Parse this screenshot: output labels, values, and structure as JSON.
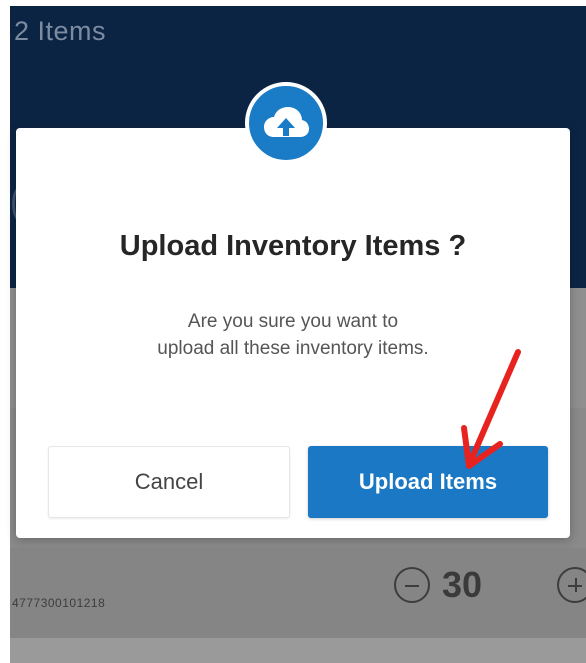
{
  "header": {
    "title": "2 Items"
  },
  "background_item": {
    "code": "4777300101218",
    "quantity": "30"
  },
  "dialog": {
    "icon": "cloud-upload-icon",
    "title": "Upload Inventory Items ?",
    "message_line1": "Are you sure you want to",
    "message_line2": "upload all these inventory items.",
    "cancel_label": "Cancel",
    "confirm_label": "Upload Items"
  },
  "colors": {
    "header_bg": "#0c2444",
    "accent": "#1a78c4",
    "annotation": "#e8231f"
  }
}
